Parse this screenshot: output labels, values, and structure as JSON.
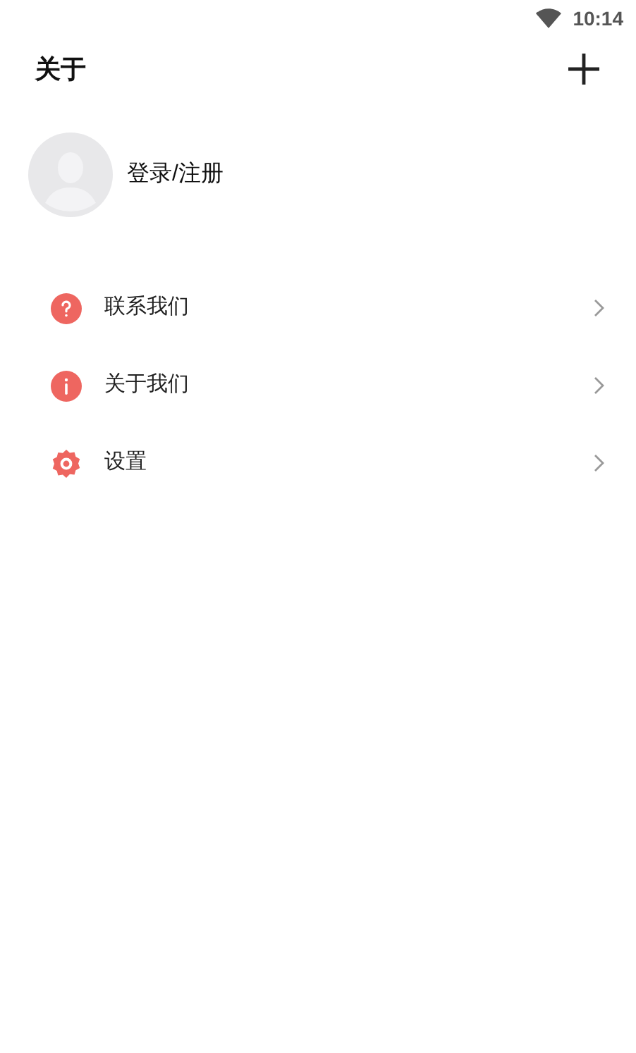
{
  "status_bar": {
    "time": "10:14"
  },
  "header": {
    "title": "关于"
  },
  "profile": {
    "label": "登录/注册"
  },
  "menu": [
    {
      "kind": "help",
      "label": "联系我们"
    },
    {
      "kind": "info",
      "label": "关于我们"
    },
    {
      "kind": "settings",
      "label": "设置"
    }
  ]
}
